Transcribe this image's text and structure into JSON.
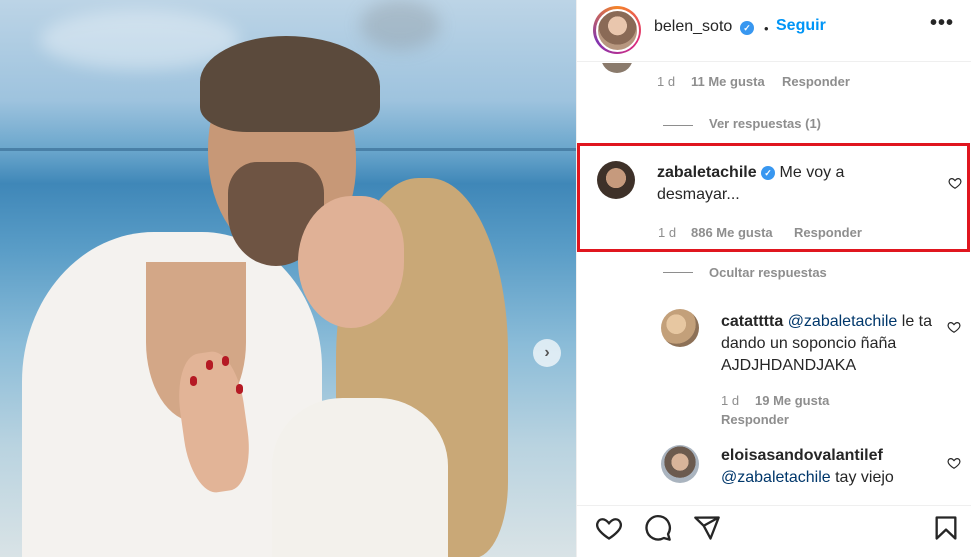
{
  "post": {
    "image_alt": "Couple embracing on the beach",
    "next_icon": "chevron-right-icon"
  },
  "header": {
    "username": "belen_soto",
    "separator": "•",
    "follow_label": "Seguir",
    "more_label": "•••"
  },
  "comments": {
    "prev_meta": {
      "time": "1 d",
      "likes": "11 Me gusta",
      "reply": "Responder"
    },
    "view_replies": "Ver respuestas (1)",
    "highlighted": {
      "username": "zabaletachile",
      "text": "Me voy a desmayar...",
      "time": "1 d",
      "likes": "886 Me gusta",
      "reply": "Responder"
    },
    "hide_replies": "Ocultar respuestas",
    "replies": [
      {
        "username": "catatttta",
        "mention": "@zabaletachile",
        "text": "le ta dando un soponcio ñaña AJDJHDANDJAKA",
        "time": "1 d",
        "likes": "19 Me gusta",
        "reply": "Responder"
      },
      {
        "username": "eloisasandovalantilef",
        "mention": "@zabaletachile",
        "text": "tay viejo"
      }
    ]
  },
  "actions": [
    "heart-icon",
    "comment-icon",
    "share-icon",
    "bookmark-icon"
  ],
  "colors": {
    "accent": "#0095f6",
    "highlight": "#e0161f",
    "verified": "#3897f0"
  }
}
